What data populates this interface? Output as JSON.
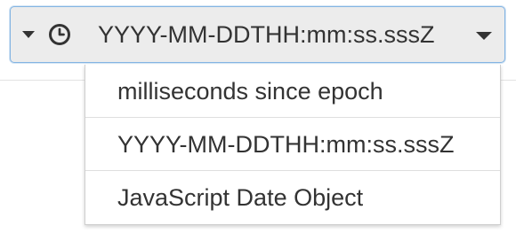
{
  "format_select": {
    "selected_value": "YYYY-MM-DDTHH:mm:ss.sssZ",
    "left_icon": "caret-down-icon",
    "type_icon": "clock-icon",
    "right_icon": "caret-down-icon"
  },
  "dropdown": {
    "options": [
      {
        "label": "milliseconds since epoch"
      },
      {
        "label": "YYYY-MM-DDTHH:mm:ss.sssZ"
      },
      {
        "label": "JavaScript Date Object"
      }
    ]
  },
  "colors": {
    "select_background": "#ececec",
    "select_focus_border": "#83b4e2",
    "text": "#333333",
    "menu_background": "#ffffff"
  }
}
